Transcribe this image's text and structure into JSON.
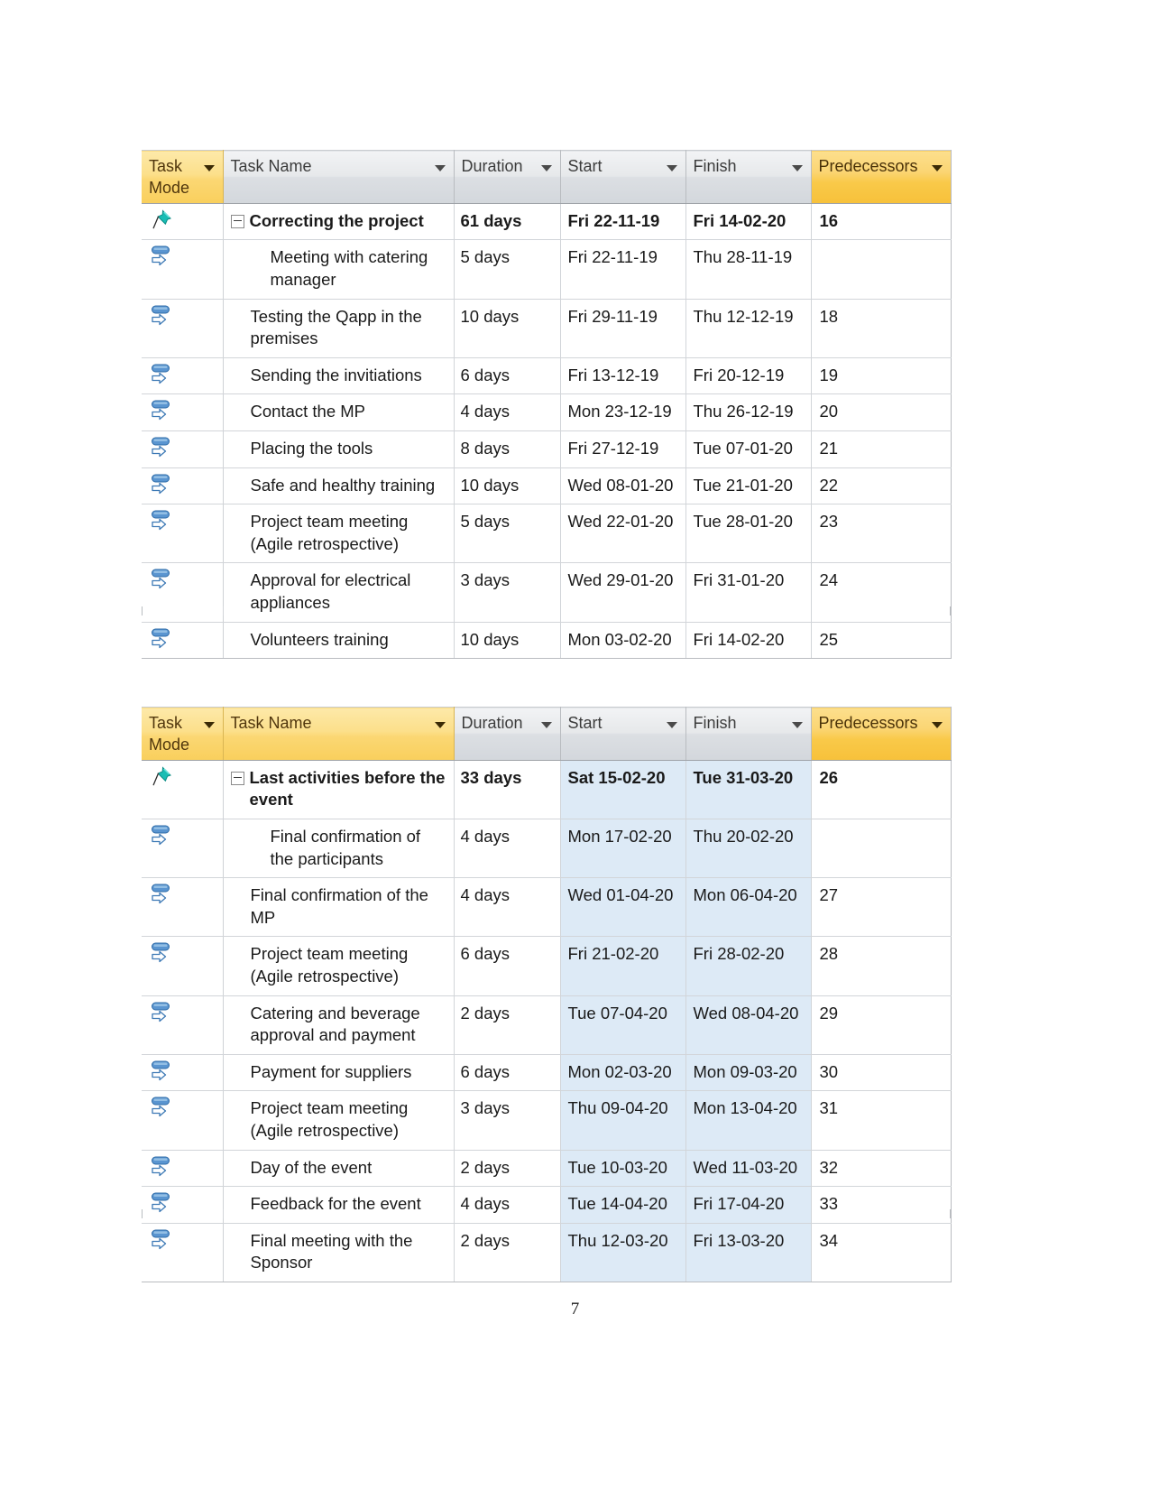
{
  "document": {
    "page_number": "7"
  },
  "icons": {
    "auto_schedule": "pushpin-icon",
    "manual_schedule": "manual-task-icon",
    "collapse": "collapse-minus-icon",
    "filter": "filter-dropdown-icon"
  },
  "columns": {
    "task_mode": "Task Mode",
    "task_name": "Task Name",
    "duration": "Duration",
    "start": "Start",
    "finish": "Finish",
    "predecessors": "Predecessors"
  },
  "colors": {
    "header_gray": "#dcdfe3",
    "header_gold": "#fbd773",
    "header_amber": "#f9c949",
    "date_highlight": "#ddeaf6",
    "pushpin_teal": "#17b4ae",
    "manual_blue": "#4a84c4",
    "grid_line": "#d2d5d9"
  },
  "tables": [
    {
      "id": "table-1",
      "task_name_header_highlighted": false,
      "rows": [
        {
          "mode": "auto",
          "indent": 0,
          "summary": true,
          "expander": true,
          "name": "Correcting the project",
          "duration": "61 days",
          "start": "Fri 22-11-19",
          "finish": "Fri 14-02-20",
          "predecessors": "16"
        },
        {
          "mode": "manual",
          "indent": 2,
          "summary": false,
          "expander": false,
          "name": "Meeting with catering manager",
          "duration": "5 days",
          "start": "Fri 22-11-19",
          "finish": "Thu 28-11-19",
          "predecessors": ""
        },
        {
          "mode": "manual",
          "indent": 1,
          "summary": false,
          "expander": false,
          "name": "Testing the Qapp in the premises",
          "duration": "10 days",
          "start": "Fri 29-11-19",
          "finish": "Thu 12-12-19",
          "predecessors": "18"
        },
        {
          "mode": "manual",
          "indent": 1,
          "summary": false,
          "expander": false,
          "name": "Sending  the invitiations",
          "duration": "6 days",
          "start": "Fri 13-12-19",
          "finish": "Fri 20-12-19",
          "predecessors": "19"
        },
        {
          "mode": "manual",
          "indent": 1,
          "summary": false,
          "expander": false,
          "name": "Contact the MP",
          "duration": "4 days",
          "start": "Mon 23-12-19",
          "finish": "Thu 26-12-19",
          "predecessors": "20"
        },
        {
          "mode": "manual",
          "indent": 1,
          "summary": false,
          "expander": false,
          "name": "Placing the tools",
          "duration": "8 days",
          "start": "Fri 27-12-19",
          "finish": "Tue 07-01-20",
          "predecessors": "21"
        },
        {
          "mode": "manual",
          "indent": 1,
          "summary": false,
          "expander": false,
          "name": "Safe and healthy training",
          "duration": "10 days",
          "start": "Wed 08-01-20",
          "finish": "Tue 21-01-20",
          "predecessors": "22"
        },
        {
          "mode": "manual",
          "indent": 1,
          "summary": false,
          "expander": false,
          "name": "Project team meeting (Agile retrospective)",
          "duration": "5 days",
          "start": "Wed 22-01-20",
          "finish": "Tue 28-01-20",
          "predecessors": "23"
        },
        {
          "mode": "manual",
          "indent": 1,
          "summary": false,
          "expander": false,
          "name": "Approval for electrical appliances",
          "duration": "3 days",
          "start": "Wed 29-01-20",
          "finish": "Fri 31-01-20",
          "predecessors": "24"
        },
        {
          "mode": "manual",
          "indent": 1,
          "summary": false,
          "expander": false,
          "name": "Volunteers training",
          "duration": "10 days",
          "start": "Mon 03-02-20",
          "finish": "Fri 14-02-20",
          "predecessors": "25"
        }
      ]
    },
    {
      "id": "table-2",
      "task_name_header_highlighted": true,
      "rows": [
        {
          "mode": "auto",
          "indent": 0,
          "summary": true,
          "expander": true,
          "name": "Last activities before the event",
          "duration": "33 days",
          "start": "Sat 15-02-20",
          "finish": "Tue 31-03-20",
          "predecessors": "26"
        },
        {
          "mode": "manual",
          "indent": 2,
          "summary": false,
          "expander": false,
          "name": "Final confirmation of the participants",
          "duration": "4 days",
          "start": "Mon 17-02-20",
          "finish": "Thu 20-02-20",
          "predecessors": ""
        },
        {
          "mode": "manual",
          "indent": 1,
          "summary": false,
          "expander": false,
          "name": "Final confirmation of the MP",
          "duration": "4 days",
          "start": "Wed 01-04-20",
          "finish": "Mon 06-04-20",
          "predecessors": "27"
        },
        {
          "mode": "manual",
          "indent": 1,
          "summary": false,
          "expander": false,
          "name": "Project team meeting (Agile retrospective)",
          "duration": "6 days",
          "start": "Fri 21-02-20",
          "finish": "Fri 28-02-20",
          "predecessors": "28"
        },
        {
          "mode": "manual",
          "indent": 1,
          "summary": false,
          "expander": false,
          "name": "Catering and beverage approval and payment",
          "duration": "2 days",
          "start": "Tue 07-04-20",
          "finish": "Wed 08-04-20",
          "predecessors": "29"
        },
        {
          "mode": "manual",
          "indent": 1,
          "summary": false,
          "expander": false,
          "name": "Payment for suppliers",
          "duration": "6 days",
          "start": "Mon 02-03-20",
          "finish": "Mon 09-03-20",
          "predecessors": "30"
        },
        {
          "mode": "manual",
          "indent": 1,
          "summary": false,
          "expander": false,
          "name": "Project team meeting (Agile retrospective)",
          "duration": "3 days",
          "start": "Thu 09-04-20",
          "finish": "Mon 13-04-20",
          "predecessors": "31"
        },
        {
          "mode": "manual",
          "indent": 1,
          "summary": false,
          "expander": false,
          "name": "Day of the event",
          "duration": "2 days",
          "start": "Tue 10-03-20",
          "finish": "Wed 11-03-20",
          "predecessors": "32"
        },
        {
          "mode": "manual",
          "indent": 1,
          "summary": false,
          "expander": false,
          "name": "Feedback for the event",
          "duration": "4 days",
          "start": "Tue 14-04-20",
          "finish": "Fri 17-04-20",
          "predecessors": "33"
        },
        {
          "mode": "manual",
          "indent": 1,
          "summary": false,
          "expander": false,
          "name": "Final meeting with the Sponsor",
          "duration": "2 days",
          "start": "Thu 12-03-20",
          "finish": "Fri 13-03-20",
          "predecessors": "34"
        }
      ]
    }
  ]
}
